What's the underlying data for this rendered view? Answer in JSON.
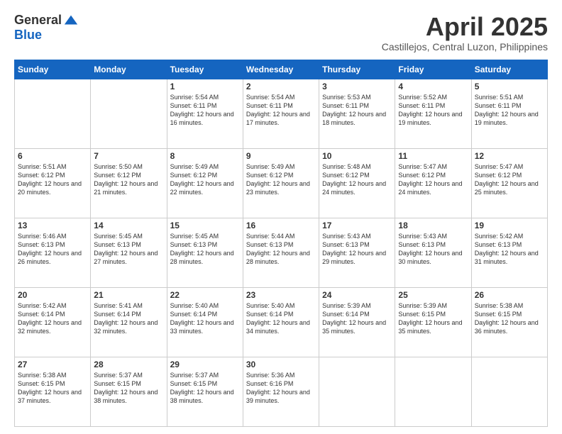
{
  "header": {
    "logo_general": "General",
    "logo_blue": "Blue",
    "month_title": "April 2025",
    "location": "Castillejos, Central Luzon, Philippines"
  },
  "days_of_week": [
    "Sunday",
    "Monday",
    "Tuesday",
    "Wednesday",
    "Thursday",
    "Friday",
    "Saturday"
  ],
  "weeks": [
    [
      {
        "day": "",
        "info": ""
      },
      {
        "day": "",
        "info": ""
      },
      {
        "day": "1",
        "info": "Sunrise: 5:54 AM\nSunset: 6:11 PM\nDaylight: 12 hours and 16 minutes."
      },
      {
        "day": "2",
        "info": "Sunrise: 5:54 AM\nSunset: 6:11 PM\nDaylight: 12 hours and 17 minutes."
      },
      {
        "day": "3",
        "info": "Sunrise: 5:53 AM\nSunset: 6:11 PM\nDaylight: 12 hours and 18 minutes."
      },
      {
        "day": "4",
        "info": "Sunrise: 5:52 AM\nSunset: 6:11 PM\nDaylight: 12 hours and 19 minutes."
      },
      {
        "day": "5",
        "info": "Sunrise: 5:51 AM\nSunset: 6:11 PM\nDaylight: 12 hours and 19 minutes."
      }
    ],
    [
      {
        "day": "6",
        "info": "Sunrise: 5:51 AM\nSunset: 6:12 PM\nDaylight: 12 hours and 20 minutes."
      },
      {
        "day": "7",
        "info": "Sunrise: 5:50 AM\nSunset: 6:12 PM\nDaylight: 12 hours and 21 minutes."
      },
      {
        "day": "8",
        "info": "Sunrise: 5:49 AM\nSunset: 6:12 PM\nDaylight: 12 hours and 22 minutes."
      },
      {
        "day": "9",
        "info": "Sunrise: 5:49 AM\nSunset: 6:12 PM\nDaylight: 12 hours and 23 minutes."
      },
      {
        "day": "10",
        "info": "Sunrise: 5:48 AM\nSunset: 6:12 PM\nDaylight: 12 hours and 24 minutes."
      },
      {
        "day": "11",
        "info": "Sunrise: 5:47 AM\nSunset: 6:12 PM\nDaylight: 12 hours and 24 minutes."
      },
      {
        "day": "12",
        "info": "Sunrise: 5:47 AM\nSunset: 6:12 PM\nDaylight: 12 hours and 25 minutes."
      }
    ],
    [
      {
        "day": "13",
        "info": "Sunrise: 5:46 AM\nSunset: 6:13 PM\nDaylight: 12 hours and 26 minutes."
      },
      {
        "day": "14",
        "info": "Sunrise: 5:45 AM\nSunset: 6:13 PM\nDaylight: 12 hours and 27 minutes."
      },
      {
        "day": "15",
        "info": "Sunrise: 5:45 AM\nSunset: 6:13 PM\nDaylight: 12 hours and 28 minutes."
      },
      {
        "day": "16",
        "info": "Sunrise: 5:44 AM\nSunset: 6:13 PM\nDaylight: 12 hours and 28 minutes."
      },
      {
        "day": "17",
        "info": "Sunrise: 5:43 AM\nSunset: 6:13 PM\nDaylight: 12 hours and 29 minutes."
      },
      {
        "day": "18",
        "info": "Sunrise: 5:43 AM\nSunset: 6:13 PM\nDaylight: 12 hours and 30 minutes."
      },
      {
        "day": "19",
        "info": "Sunrise: 5:42 AM\nSunset: 6:13 PM\nDaylight: 12 hours and 31 minutes."
      }
    ],
    [
      {
        "day": "20",
        "info": "Sunrise: 5:42 AM\nSunset: 6:14 PM\nDaylight: 12 hours and 32 minutes."
      },
      {
        "day": "21",
        "info": "Sunrise: 5:41 AM\nSunset: 6:14 PM\nDaylight: 12 hours and 32 minutes."
      },
      {
        "day": "22",
        "info": "Sunrise: 5:40 AM\nSunset: 6:14 PM\nDaylight: 12 hours and 33 minutes."
      },
      {
        "day": "23",
        "info": "Sunrise: 5:40 AM\nSunset: 6:14 PM\nDaylight: 12 hours and 34 minutes."
      },
      {
        "day": "24",
        "info": "Sunrise: 5:39 AM\nSunset: 6:14 PM\nDaylight: 12 hours and 35 minutes."
      },
      {
        "day": "25",
        "info": "Sunrise: 5:39 AM\nSunset: 6:15 PM\nDaylight: 12 hours and 35 minutes."
      },
      {
        "day": "26",
        "info": "Sunrise: 5:38 AM\nSunset: 6:15 PM\nDaylight: 12 hours and 36 minutes."
      }
    ],
    [
      {
        "day": "27",
        "info": "Sunrise: 5:38 AM\nSunset: 6:15 PM\nDaylight: 12 hours and 37 minutes."
      },
      {
        "day": "28",
        "info": "Sunrise: 5:37 AM\nSunset: 6:15 PM\nDaylight: 12 hours and 38 minutes."
      },
      {
        "day": "29",
        "info": "Sunrise: 5:37 AM\nSunset: 6:15 PM\nDaylight: 12 hours and 38 minutes."
      },
      {
        "day": "30",
        "info": "Sunrise: 5:36 AM\nSunset: 6:16 PM\nDaylight: 12 hours and 39 minutes."
      },
      {
        "day": "",
        "info": ""
      },
      {
        "day": "",
        "info": ""
      },
      {
        "day": "",
        "info": ""
      }
    ]
  ]
}
